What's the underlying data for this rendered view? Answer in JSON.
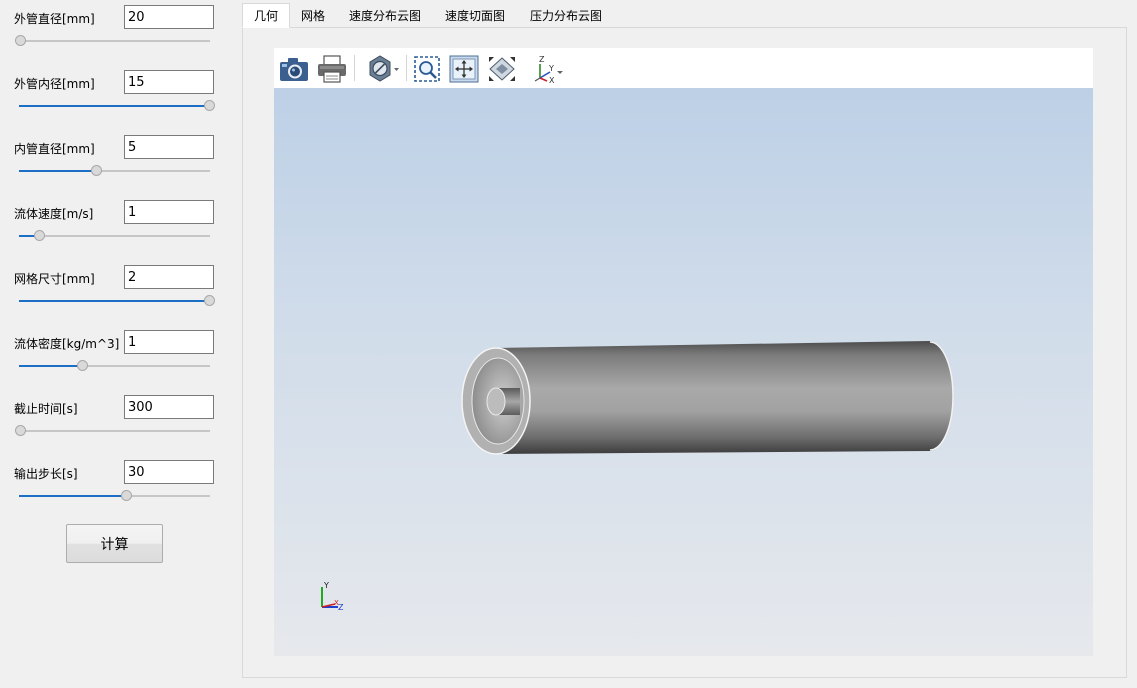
{
  "params": [
    {
      "label": "外管直径[mm]",
      "value": "20",
      "slider_fraction": 0.0
    },
    {
      "label": "外管内径[mm]",
      "value": "15",
      "slider_fraction": 1.0
    },
    {
      "label": "内管直径[mm]",
      "value": "5",
      "slider_fraction": 0.4
    },
    {
      "label": "流体速度[m/s]",
      "value": "1",
      "slider_fraction": 0.1
    },
    {
      "label": "网格尺寸[mm]",
      "value": "2",
      "slider_fraction": 1.0
    },
    {
      "label": "流体密度[kg/m^3]",
      "value": "1",
      "slider_fraction": 0.33
    },
    {
      "label": "截止时间[s]",
      "value": "300",
      "slider_fraction": 0.0
    },
    {
      "label": "输出步长[s]",
      "value": "30",
      "slider_fraction": 0.56
    }
  ],
  "calc_button": "计算",
  "tabs": [
    {
      "label": "几何",
      "active": true
    },
    {
      "label": "网格",
      "active": false
    },
    {
      "label": "速度分布云图",
      "active": false
    },
    {
      "label": "速度切面图",
      "active": false
    },
    {
      "label": "压力分布云图",
      "active": false
    }
  ],
  "toolbar": [
    {
      "icon": "camera-icon"
    },
    {
      "icon": "print-icon"
    },
    {
      "icon": "display-mode-icon"
    },
    {
      "icon": "zoom-box-icon"
    },
    {
      "icon": "fit-all-icon"
    },
    {
      "icon": "view-direction-icon"
    },
    {
      "icon": "axes-icon"
    }
  ],
  "axes": {
    "x": "X",
    "y": "Y",
    "z": "Z"
  },
  "colors": {
    "accent": "#1c6fc5",
    "viewport_top": "#bdd0e6",
    "viewport_bottom": "#e6e8ec"
  }
}
